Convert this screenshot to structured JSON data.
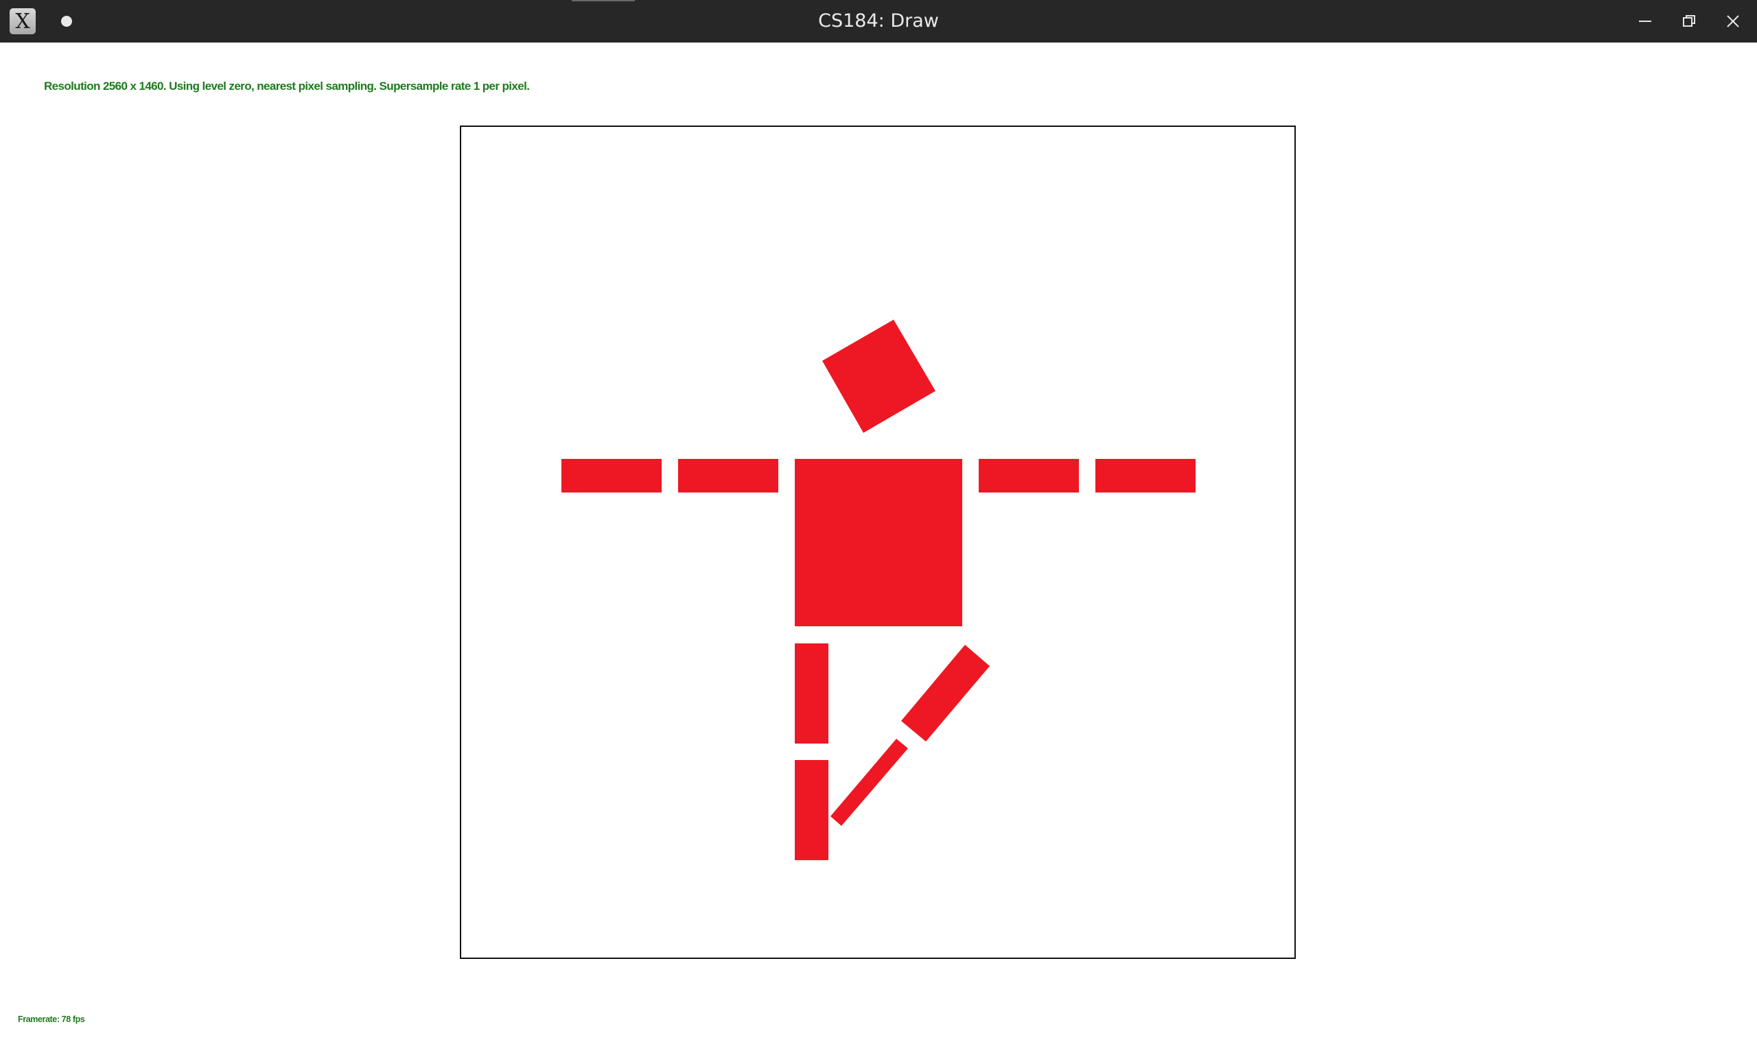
{
  "window": {
    "title": "CS184: Draw",
    "app_icon": "x-window-icon",
    "app_icon_glyph": "X",
    "controls": [
      "minimize-icon",
      "restore-icon",
      "close-icon"
    ]
  },
  "status": {
    "text": "Resolution 2560 x 1460. Using level zero, nearest pixel sampling. Supersample rate 1 per pixel.",
    "color": "#1f7a1f"
  },
  "framerate": {
    "text": "Framerate: 78 fps"
  },
  "canvas": {
    "background": "#ffffff",
    "border_color": "#111111",
    "figure_color": "#ed1823"
  }
}
